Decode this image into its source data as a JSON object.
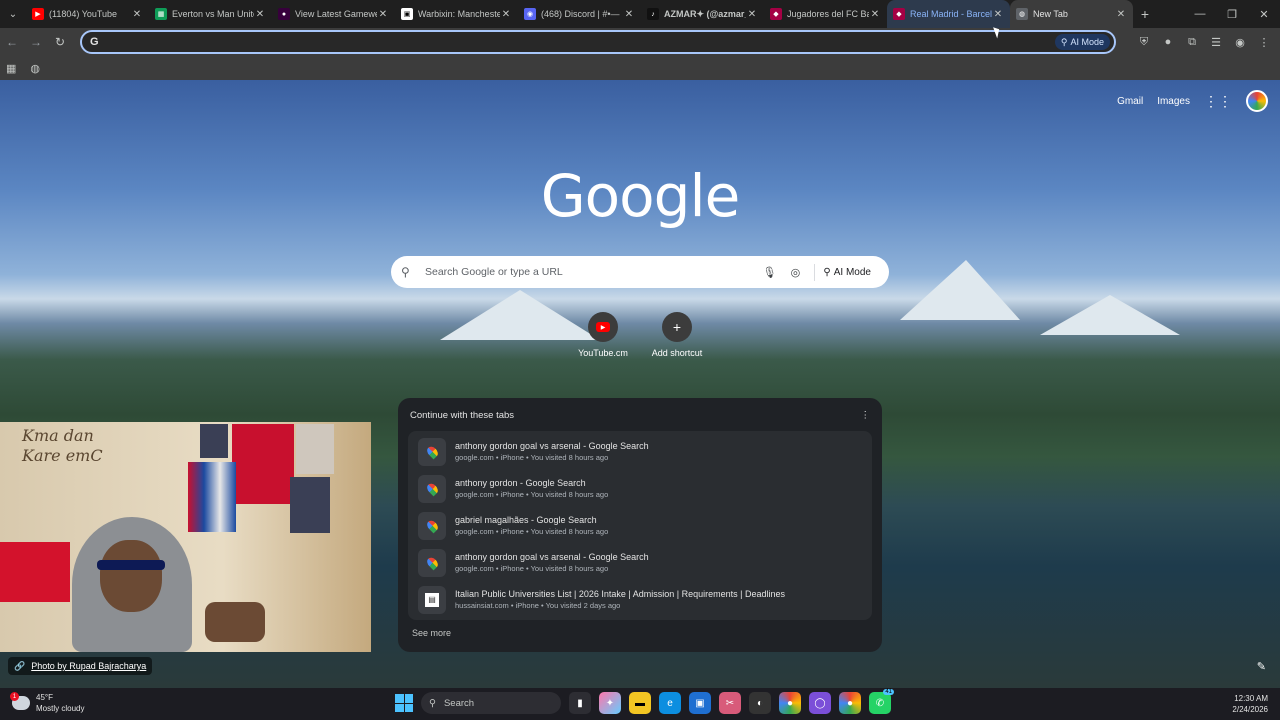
{
  "browser": {
    "tabs": [
      {
        "label": "(11804) YouTube",
        "fav_color": "#ff0000",
        "fav": "▶"
      },
      {
        "label": "Everton vs Man United",
        "fav_color": "#0f9d58",
        "fav": "▦"
      },
      {
        "label": "View Latest Gamewe",
        "fav_color": "#37003c",
        "fav": "●"
      },
      {
        "label": "Warbixin: Manchester",
        "fav_color": "#ffffff",
        "fav": "▣"
      },
      {
        "label": "(468) Discord | #•—",
        "fav_color": "#5865f2",
        "fav": "◉"
      },
      {
        "label": "AZMAR✦ (@azmar_",
        "fav_color": "#111111",
        "fav": "♪"
      },
      {
        "label": "Jugadores del FC Barc",
        "fav_color": "#a50044",
        "fav": "◆"
      },
      {
        "label": "Real Madrid - Barcelo",
        "fav_color": "#a50044",
        "fav": "◆"
      },
      {
        "label": "New Tab",
        "fav_color": "#5f6368",
        "fav": "◍"
      }
    ],
    "active_tab": 8,
    "omnibox_ai_label": "AI Mode",
    "omnibox_value": ""
  },
  "ntp": {
    "top_links": {
      "gmail": "Gmail",
      "images": "Images"
    },
    "logo": "Google",
    "search_placeholder": "Search Google or type a URL",
    "ai_mode": "AI Mode",
    "shortcuts": [
      {
        "label": "YouTube.cm",
        "icon": "youtube-icon"
      },
      {
        "label": "Add shortcut",
        "icon": "plus-icon"
      }
    ],
    "resume": {
      "title": "Continue with these tabs",
      "items": [
        {
          "title": "anthony gordon goal vs arsenal - Google Search",
          "sub": "google.com • iPhone • You visited 8 hours ago",
          "icon": "google-maps-pin-icon"
        },
        {
          "title": "anthony gordon - Google Search",
          "sub": "google.com • iPhone • You visited 8 hours ago",
          "icon": "google-maps-pin-icon"
        },
        {
          "title": "gabriel magalhães - Google Search",
          "sub": "google.com • iPhone • You visited 8 hours ago",
          "icon": "google-maps-pin-icon"
        },
        {
          "title": "anthony gordon goal vs arsenal - Google Search",
          "sub": "google.com • iPhone • You visited 8 hours ago",
          "icon": "google-maps-pin-icon"
        },
        {
          "title": "Italian Public Universities List | 2026 Intake | Admission | Requirements | Deadlines",
          "sub": "hussainsiat.com • iPhone • You visited 2 days ago",
          "icon": "site-favicon-icon"
        }
      ],
      "see_more": "See more"
    },
    "credit": "Photo by Rupad Bajracharya",
    "webcam_text": "Kma dan\nKare emC"
  },
  "taskbar": {
    "weather_temp": "45°F",
    "weather_desc": "Mostly cloudy",
    "weather_badge": "1",
    "search_label": "Search",
    "time": "12:30 AM",
    "date": "2/24/2026",
    "whatsapp_count": "41"
  },
  "colors": {
    "accent": "#a8c7fa",
    "panel_bg": "#1f2226"
  }
}
